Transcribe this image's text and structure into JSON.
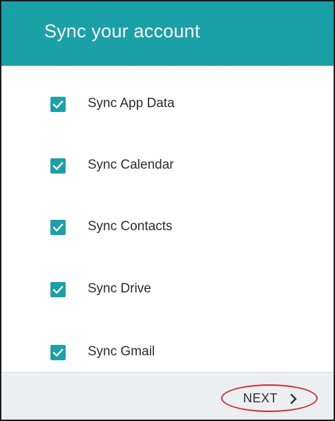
{
  "header": {
    "title": "Sync your account"
  },
  "sync_items": [
    {
      "label": "Sync App Data",
      "checked": true
    },
    {
      "label": "Sync Calendar",
      "checked": true
    },
    {
      "label": "Sync Contacts",
      "checked": true
    },
    {
      "label": "Sync Drive",
      "checked": true
    },
    {
      "label": "Sync Gmail",
      "checked": true
    }
  ],
  "footer": {
    "next_label": "NEXT",
    "next_icon": "chevron-right-icon"
  },
  "colors": {
    "accent": "#1aa1a8",
    "footer_bg": "#eceff1",
    "highlight": "#d9262b"
  }
}
